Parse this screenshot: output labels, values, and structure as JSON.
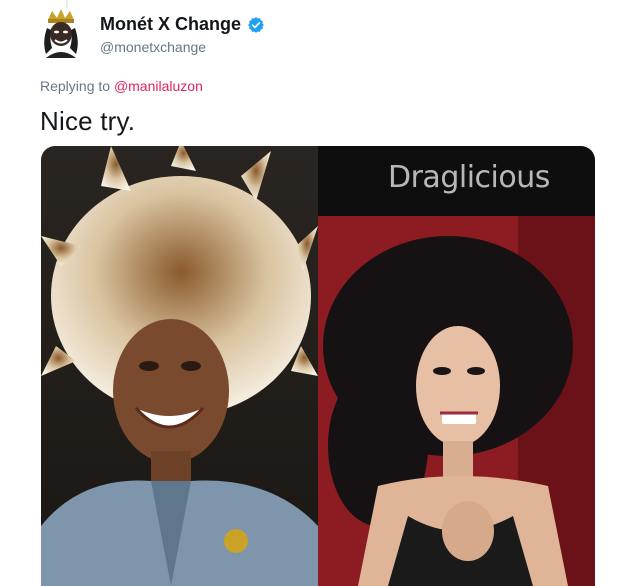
{
  "tweet": {
    "author": {
      "display_name": "Monét X Change",
      "handle": "@monetxchange",
      "verified": true,
      "avatar_icon": "avatar-crowned-portrait"
    },
    "reply": {
      "prefix": "Replying to",
      "mention": "@manilaluzon"
    },
    "text": "Nice try.",
    "media": {
      "left_photo": "concert-performer-spiky-hair-photo",
      "right_photo": "drag-performer-big-hair-photo",
      "watermark_logo": "Draglicious"
    }
  },
  "colors": {
    "verified_blue": "#1da1f2",
    "mention_pink": "#e0245e",
    "meta_gray": "#657786"
  }
}
